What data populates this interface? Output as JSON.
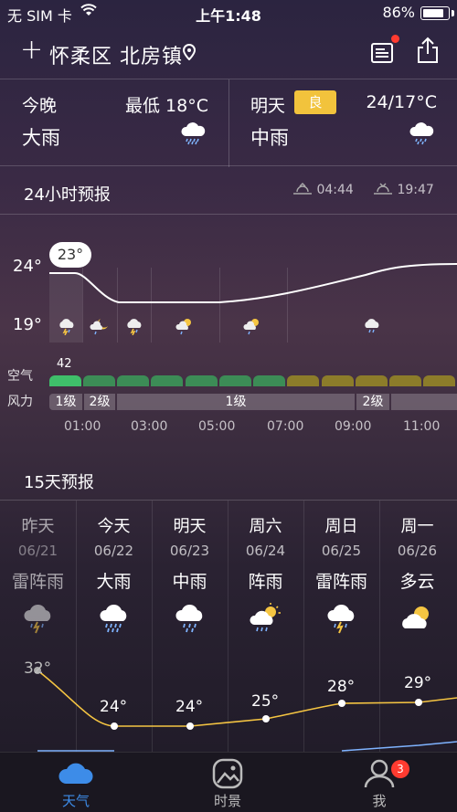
{
  "status": {
    "carrier": "无 SIM 卡",
    "time": "上午1:48",
    "battery": "86%",
    "battery_level": 0.86
  },
  "header": {
    "location": "怀柔区 北房镇"
  },
  "today": {
    "label": "今晚",
    "range": "最低 18°C",
    "condition": "大雨"
  },
  "tomorrow": {
    "label": "明天",
    "aqi_badge": "良",
    "range": "24/17°C",
    "condition": "中雨"
  },
  "hourly": {
    "title": "24小时预报",
    "sunrise": "04:44",
    "sunset": "19:47",
    "y_high": "24°",
    "y_low": "19°",
    "current_temp": "23°",
    "air_label": "空气",
    "wind_label": "风力",
    "aqi_value": "42",
    "wind": [
      "1级",
      "2级",
      "1级",
      "2级"
    ],
    "times": [
      "01:00",
      "03:00",
      "05:00",
      "07:00",
      "09:00",
      "11:00"
    ]
  },
  "daily": {
    "title": "15天预报",
    "days": [
      {
        "name": "昨天",
        "date": "06/21",
        "cond": "雷阵雨",
        "high": "32°",
        "icon": "thunderstorm-icon"
      },
      {
        "name": "今天",
        "date": "06/22",
        "cond": "大雨",
        "high": "24°",
        "icon": "heavy-rain-icon"
      },
      {
        "name": "明天",
        "date": "06/23",
        "cond": "中雨",
        "high": "24°",
        "icon": "moderate-rain-icon"
      },
      {
        "name": "周六",
        "date": "06/24",
        "cond": "阵雨",
        "high": "25°",
        "icon": "shower-icon"
      },
      {
        "name": "周日",
        "date": "06/25",
        "cond": "雷阵雨",
        "high": "28°",
        "icon": "thunderstorm-icon"
      },
      {
        "name": "周一",
        "date": "06/26",
        "cond": "多云",
        "high": "29°",
        "icon": "partly-cloudy-icon"
      }
    ]
  },
  "tabs": [
    {
      "label": "天气",
      "icon": "cloud-icon"
    },
    {
      "label": "时景",
      "icon": "photo-icon"
    },
    {
      "label": "我",
      "icon": "user-icon",
      "badge": "3"
    }
  ]
}
